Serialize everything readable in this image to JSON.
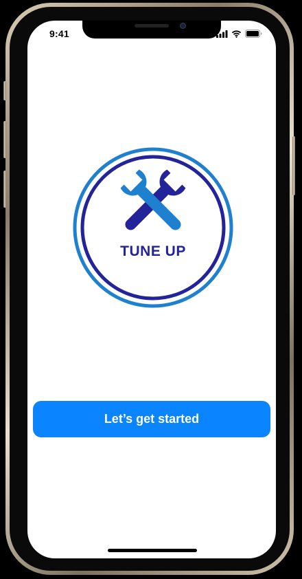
{
  "status_bar": {
    "time": "9:41",
    "icons": [
      "cellular-signal-icon",
      "wifi-icon",
      "battery-icon"
    ]
  },
  "logo": {
    "text": "TUNE UP",
    "icon": "crossed-wrenches-icon",
    "colors": {
      "outer_ring": "#1f80d0",
      "inner_ring": "#23239a",
      "wrench_light": "#1f80d0",
      "wrench_dark": "#23239a"
    }
  },
  "cta": {
    "label": "Let’s get started",
    "color": "#0a84ff"
  }
}
